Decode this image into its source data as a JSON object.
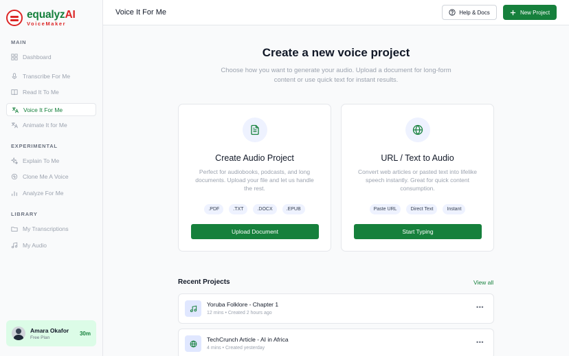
{
  "brand": {
    "name_part1": "equalyz",
    "name_part2": "AI",
    "subtitle": "VoiceMaker",
    "logo_icon": "equals-circle-icon"
  },
  "sidebar": {
    "sections": [
      {
        "label": "MAIN"
      },
      {
        "label": "EXPERIMENTAL"
      },
      {
        "label": "LIBRARY"
      }
    ],
    "items": [
      {
        "label": "Dashboard",
        "icon": "grid-icon"
      },
      {
        "label": "Transcribe For Me",
        "icon": "microphone-icon"
      },
      {
        "label": "Read It To Me",
        "icon": "book-icon"
      },
      {
        "label": "Voice It For Me",
        "icon": "translate-icon",
        "active": true
      },
      {
        "label": "Animate It for Me",
        "icon": "translate-icon"
      },
      {
        "label": "Explain To Me",
        "icon": "sparkles-icon"
      },
      {
        "label": "Clone Me A Voice",
        "icon": "voice-clone-icon"
      },
      {
        "label": "Analyze For Me",
        "icon": "bar-chart-icon"
      },
      {
        "label": "My Transcriptions",
        "icon": "folder-icon"
      },
      {
        "label": "My Audio",
        "icon": "music-note-icon"
      }
    ]
  },
  "user": {
    "name": "Amara Okafor",
    "plan": "Free Plan",
    "credits": "30m"
  },
  "header": {
    "title": "Voice It For Me",
    "help_label": "Help & Docs",
    "new_label": "New Project"
  },
  "main": {
    "title": "Create a new voice project",
    "subtitle": "Choose how you want to generate your audio. Upload a document for long-form content or use quick text for instant results."
  },
  "cards": [
    {
      "title": "Create Audio Project",
      "description": "Perfect for audiobooks, podcasts, and long documents. Upload your file and let us handle the rest.",
      "tags": [
        ".PDF",
        ".TXT",
        ".DOCX",
        ".EPUB"
      ],
      "button": "Upload Document",
      "icon": "document-icon"
    },
    {
      "title": "URL / Text to Audio",
      "description": "Convert web articles or pasted text into lifelike speech instantly. Great for quick content consumption.",
      "tags": [
        "Paste URL",
        "Direct Text",
        "Instant"
      ],
      "button": "Start Typing",
      "icon": "globe-icon"
    }
  ],
  "recent": {
    "title": "Recent Projects",
    "view_all": "View all",
    "items": [
      {
        "title": "Yoruba Folklore - Chapter 1",
        "meta": "12 mins • Created 2 hours ago",
        "icon": "music-note-icon"
      },
      {
        "title": "TechCrunch Article - AI in Africa",
        "meta": "4 mins • Created yesterday",
        "icon": "globe-icon"
      }
    ]
  },
  "colors": {
    "accent": "#16803c",
    "brand_red": "#dc2626",
    "active_bg": "#dcfce7"
  }
}
